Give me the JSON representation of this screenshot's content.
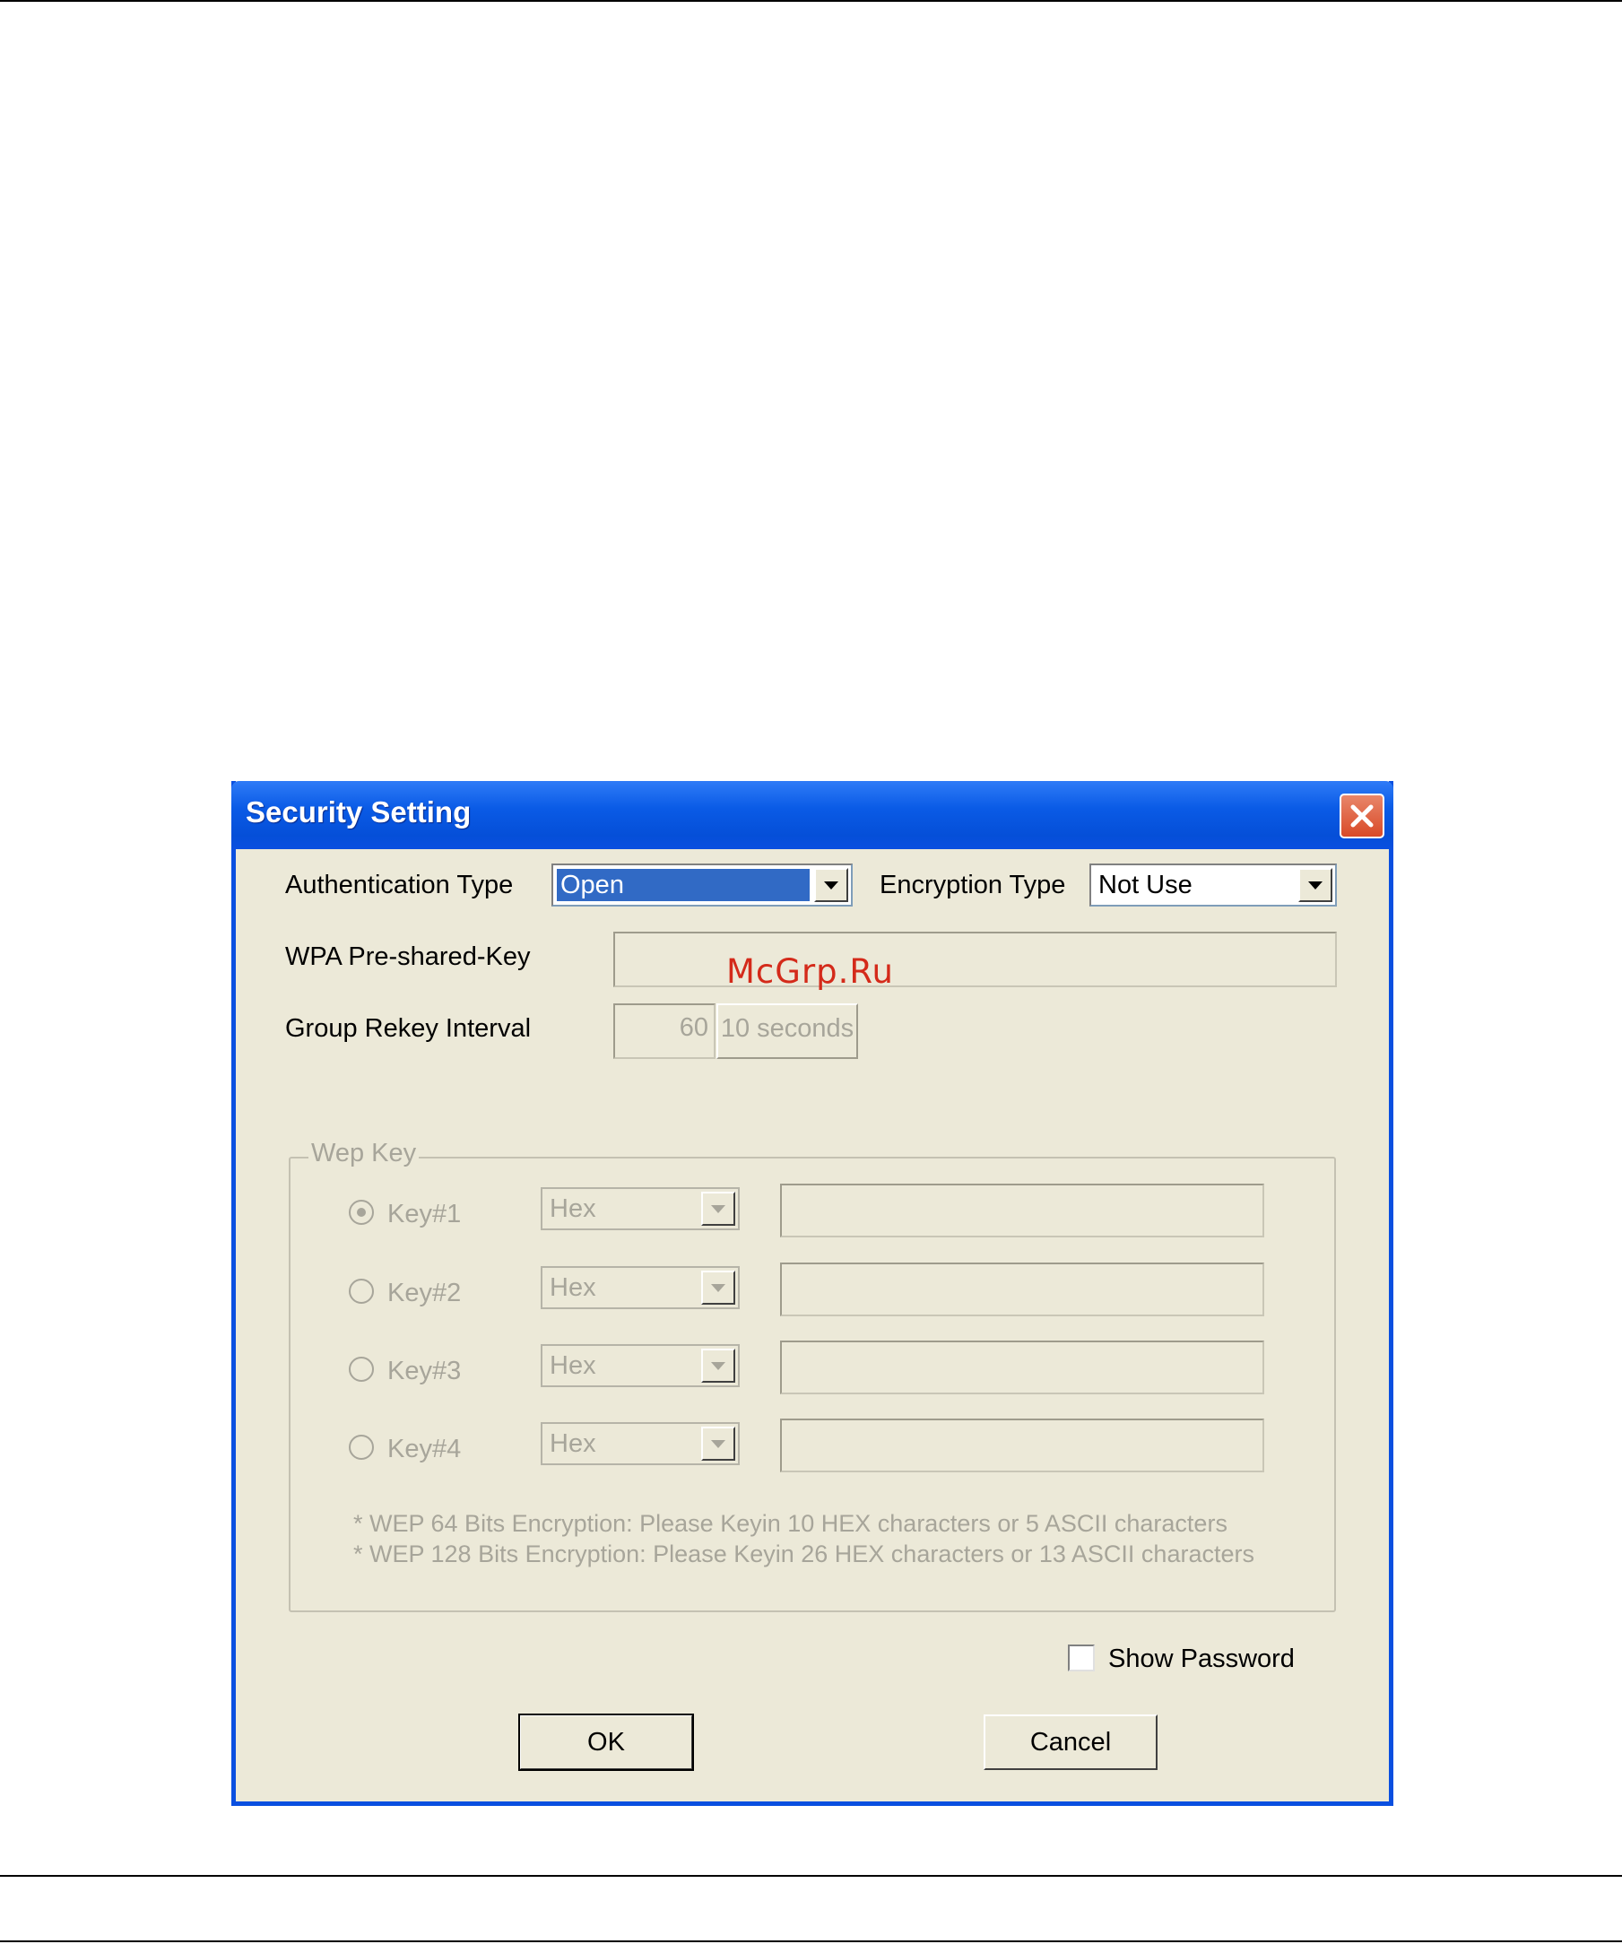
{
  "dialog": {
    "title": "Security Setting",
    "auth_label": "Authentication Type",
    "auth_value": "Open",
    "enc_label": "Encryption Type",
    "enc_value": "Not Use",
    "wpa_label": "WPA Pre-shared-Key",
    "rekey_label": "Group Rekey Interval",
    "rekey_value": "60",
    "rekey_unit": "10 seconds",
    "wep_group_label": "Wep Key",
    "wep_keys": [
      {
        "label": "Key#1",
        "format": "Hex",
        "checked": true
      },
      {
        "label": "Key#2",
        "format": "Hex",
        "checked": false
      },
      {
        "label": "Key#3",
        "format": "Hex",
        "checked": false
      },
      {
        "label": "Key#4",
        "format": "Hex",
        "checked": false
      }
    ],
    "note_64": "* WEP 64 Bits Encryption:  Please Keyin 10 HEX characters or 5 ASCII characters",
    "note_128": "* WEP 128 Bits Encryption:  Please Keyin 26 HEX characters or 13 ASCII characters",
    "show_password_label": "Show Password",
    "ok_label": "OK",
    "cancel_label": "Cancel"
  },
  "watermark": "McGrp.Ru",
  "icons": {
    "close": "close-icon",
    "dropdown": "chevron-down-icon"
  },
  "colors": {
    "titlebar": "#0a5be6",
    "dialog_bg": "#ece9d8",
    "selection": "#316ac5",
    "close_button": "#d94a28"
  }
}
